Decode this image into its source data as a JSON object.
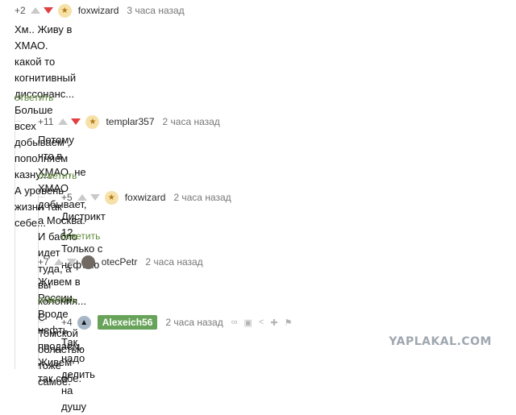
{
  "comments": [
    {
      "rating": "+2",
      "author": "foxwizard",
      "time": "3 часа назад",
      "text": "Хм.. Живу в ХМАО.\nкакой то когнитивный диссонанс...\nБольше всех добываем , пополняем казну....\nА уровень жизни так себе...",
      "reply": "ответить",
      "avatar_color": "#f6e1a8",
      "vote": "down"
    },
    {
      "rating": "+11",
      "author": "templar357",
      "time": "2 часа назад",
      "text": "Потому что в ХМАО, не ХМАО добывает, а Москва. И бабло идет туда, а вы колония...\nС Томской областью тоже самое.",
      "reply": "ответить",
      "avatar_color": "#f6e1a8",
      "vote": "down"
    },
    {
      "rating": "+5",
      "author": "foxwizard",
      "time": "2 часа назад",
      "text": "Дистрикт 12. Только с нефтью",
      "reply": "ответить",
      "avatar_color": "#f6e1a8",
      "vote": "none"
    },
    {
      "rating": "+7",
      "author": "otecPetr",
      "time": "2 часа назад",
      "text": "Живем в России. Вроде нефть продаем. Живем так себе.",
      "reply": "ответить",
      "avatar_color": "#706a63",
      "vote": "none"
    },
    {
      "rating": "+4",
      "author": "Alexeich56",
      "time": "2 часа назад",
      "text": "Так надо делить на душу",
      "reply": "",
      "avatar_color": "#a7b7c7",
      "vote": "none",
      "badge_color": "#68a35a"
    }
  ],
  "icons": [
    "link-icon",
    "save-icon",
    "share-icon",
    "pin-icon",
    "flag-icon"
  ],
  "watermark": "YAPLAKAL.COM"
}
